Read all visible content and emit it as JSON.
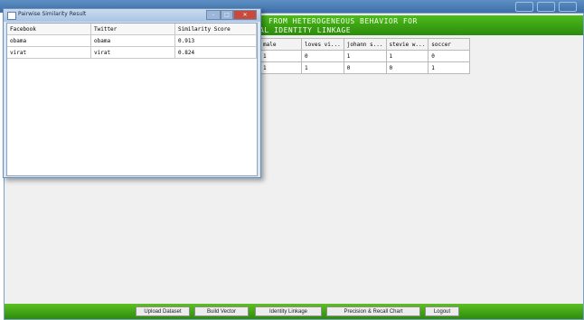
{
  "app": {
    "header_line1": "FROM HETEROGENEOUS BEHAVIOR FOR",
    "header_line2": "AL IDENTITY LINKAGE",
    "table": {
      "columns": [
        "male",
        "loves vi...",
        "johann s...",
        "stevie w...",
        "soccer"
      ],
      "rows": [
        [
          "1",
          "0",
          "1",
          "1",
          "0"
        ],
        [
          "1",
          "1",
          "0",
          "0",
          "1"
        ]
      ]
    },
    "buttons": {
      "upload": "Upload Dataset",
      "build": "Build Vector",
      "identity": "Identity Linkage",
      "precision": "Precision & Recall Chart",
      "logout": "Logout"
    }
  },
  "popup": {
    "title": "Pairwise Similarity Result",
    "columns": [
      "Facebook",
      "Twitter",
      "Similarity Score"
    ],
    "rows": [
      [
        "obama",
        "obama",
        "0.913"
      ],
      [
        "virat",
        "virat",
        "0.824"
      ]
    ]
  },
  "colors": {
    "header_green": "#2c8b0c",
    "close_red": "#c74a3c"
  }
}
